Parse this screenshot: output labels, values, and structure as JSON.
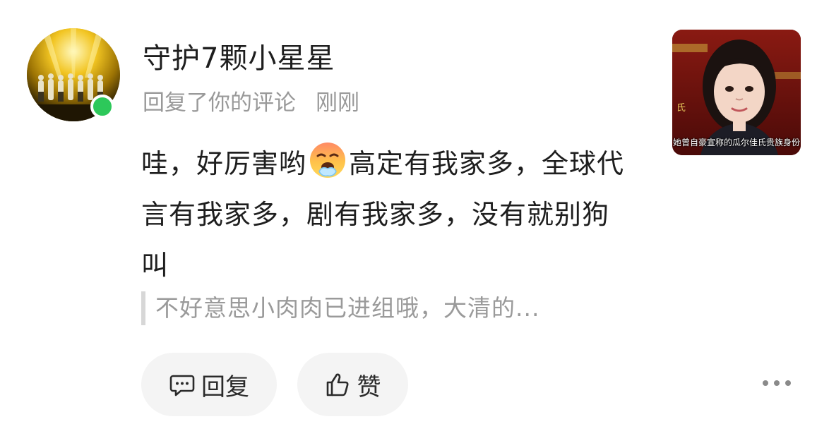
{
  "user": {
    "name": "守护7颗小星星",
    "avatar_icon": "concert-stage-avatar",
    "online_color": "#2dc85a"
  },
  "meta": {
    "action": "回复了你的评论",
    "time": "刚刚"
  },
  "comment": {
    "part1": "哇，好厉害哟",
    "emoji_icon": "exhale-steam-emoji",
    "part2": "高定有我家多，全球代言有我家多，剧有我家多，没有就别狗叫"
  },
  "quote": {
    "text": "不好意思小肉肉已进组哦，大清的..."
  },
  "thumbnail": {
    "caption": "她曾自豪宣称的瓜尔佳氏贵族身份",
    "side_text": "氏"
  },
  "actions": {
    "reply_label": "回复",
    "like_label": "赞",
    "more_icon": "more-dots-icon"
  }
}
